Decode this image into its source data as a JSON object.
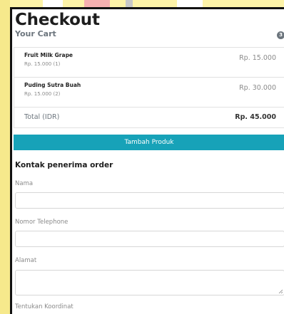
{
  "checkout": {
    "title": "Checkout",
    "cart_heading": "Your Cart",
    "cart_count": "3"
  },
  "cart": {
    "items": [
      {
        "name": "Fruit Milk Grape",
        "sub": "Rp. 15.000 (1)",
        "price": "Rp. 15.000"
      },
      {
        "name": "Puding Sutra Buah",
        "sub": "Rp. 15.000 (2)",
        "price": "Rp. 30.000"
      }
    ],
    "total_label": "Total (IDR)",
    "total_value": "Rp. 45.000"
  },
  "actions": {
    "add_product": "Tambah Produk"
  },
  "contact": {
    "title": "Kontak penerima order",
    "name_label": "Nama",
    "phone_label": "Nomor Telephone",
    "address_label": "Alamat",
    "coordinate_label": "Tentukan Koordinat"
  },
  "colors": {
    "accent": "#17a2b8",
    "badge": "#6c757d",
    "background": "#fdf3a8"
  }
}
